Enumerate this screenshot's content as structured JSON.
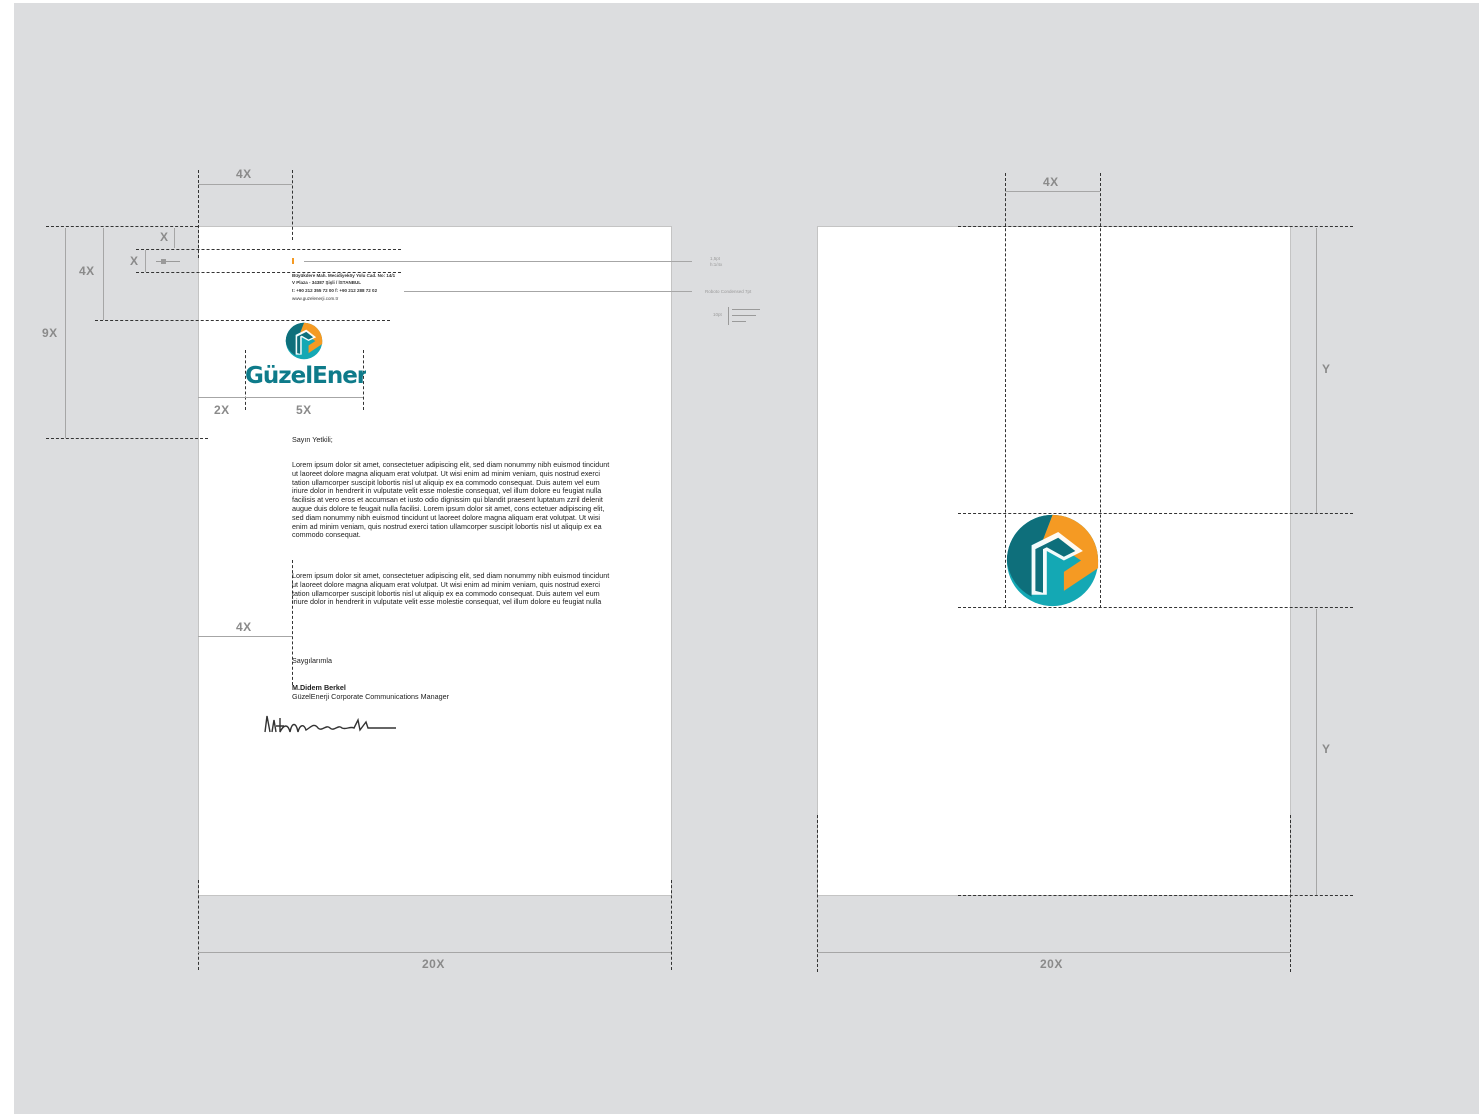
{
  "colors": {
    "background": "#dcdddf",
    "teal_dark": "#0e6f7b",
    "teal_light": "#14a8b4",
    "orange": "#f59a23",
    "guide": "#a6a6a6"
  },
  "left_sheet": {
    "dimensions": {
      "top_width": "4X",
      "x_top": "X",
      "x_side": "X",
      "four_x_side": "4X",
      "nine_x": "9X",
      "two_x": "2X",
      "five_x": "5X",
      "margin_4x": "4X",
      "bottom_width": "20X"
    },
    "annotations": {
      "rule_weight": "1,5pt",
      "rule_ratio": "h:1/4x",
      "font": "Roboto Condensed 7pt",
      "size": "10pt"
    },
    "address": {
      "line1": "Büyükdere Mah. Mecidiyeköy Yolu Cad. No: 14/1",
      "line2": "V Plaza - 34387 Şişli / İSTANBUL",
      "line3": "t: +90 212 355 72 00 f: +90 212 288 72 02",
      "line4": "www.guzelenerji.com.tr"
    },
    "logo": {
      "icon": "guzelenerji-logo-icon",
      "wordmark": "GüzelEnerji"
    },
    "letter": {
      "salutation": "Sayın Yetkili;",
      "paragraph1": "Lorem ipsum dolor sit amet, consectetuer adipiscing elit, sed diam nonummy nibh euismod tincidunt ut laoreet dolore magna aliquam erat volutpat. Ut wisi enim ad minim veniam, quis nostrud exerci tation ullamcorper suscipit lobortis nisl ut aliquip ex ea commodo consequat. Duis autem vel eum iriure dolor in hendrerit in vulputate velit esse molestie consequat, vel illum dolore eu feugiat nulla facilisis at vero eros et accumsan et iusto odio dignissim qui blandit praesent luptatum zzril delenit augue duis dolore te feugait nulla facilisi. Lorem ipsum dolor sit amet, cons ectetuer adipiscing elit, sed diam nonummy nibh euismod tincidunt ut laoreet dolore magna aliquam erat volutpat. Ut wisi enim ad minim veniam, quis nostrud exerci tation ullamcorper suscipit lobortis nisl ut aliquip ex ea commodo consequat.",
      "paragraph2": "Lorem ipsum dolor sit amet, consectetuer adipiscing elit, sed diam nonummy nibh euismod tincidunt ut laoreet dolore magna aliquam erat volutpat. Ut wisi enim ad minim veniam, quis nostrud exerci tation ullamcorper suscipit lobortis nisl ut aliquip ex ea commodo consequat. Duis autem vel eum iriure dolor in hendrerit in vulputate velit esse molestie consequat, vel illum dolore eu feugiat nulla",
      "closing": "Saygılarımla",
      "signer_name": "M.Didem Berkel",
      "signer_title": "GüzelEnerji Corporate Communications Manager"
    }
  },
  "right_sheet": {
    "dimensions": {
      "top_width": "4X",
      "upper_y": "Y",
      "lower_y": "Y",
      "bottom_width": "20X"
    },
    "logo": {
      "icon": "guzelenerji-logo-icon"
    }
  }
}
